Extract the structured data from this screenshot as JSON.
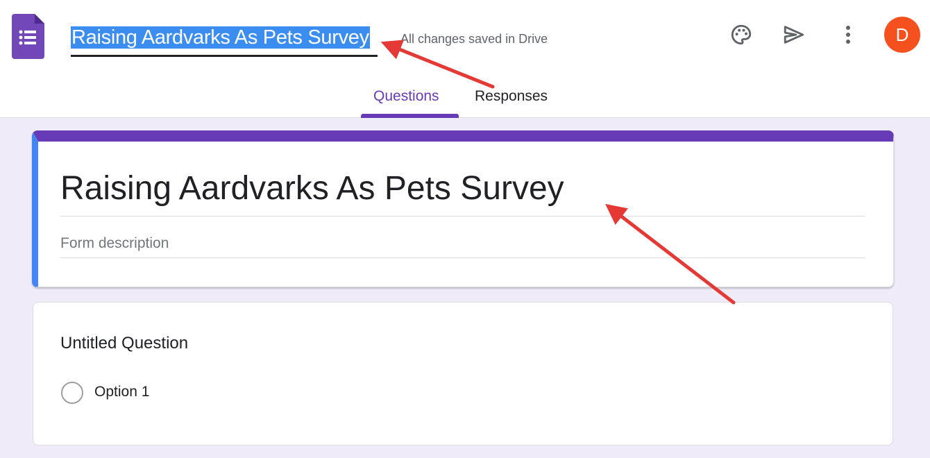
{
  "header": {
    "doc_title": "Raising Aardvarks As Pets Survey",
    "save_status": "All changes saved in Drive",
    "avatar_letter": "D",
    "icons": [
      "forms-logo-icon",
      "palette-icon",
      "send-icon",
      "more-vert-icon"
    ]
  },
  "tabs": [
    {
      "label": "Questions",
      "active": true
    },
    {
      "label": "Responses",
      "active": false
    }
  ],
  "form": {
    "title": "Raising Aardvarks As Pets Survey",
    "description_placeholder": "Form description"
  },
  "question": {
    "title": "Untitled Question",
    "options": [
      "Option 1"
    ]
  },
  "colors": {
    "accent": "#673ab7",
    "selection": "#3b8df0",
    "avatar": "#f4511e",
    "annotation": "#e53935",
    "background": "#f0ebf8"
  }
}
